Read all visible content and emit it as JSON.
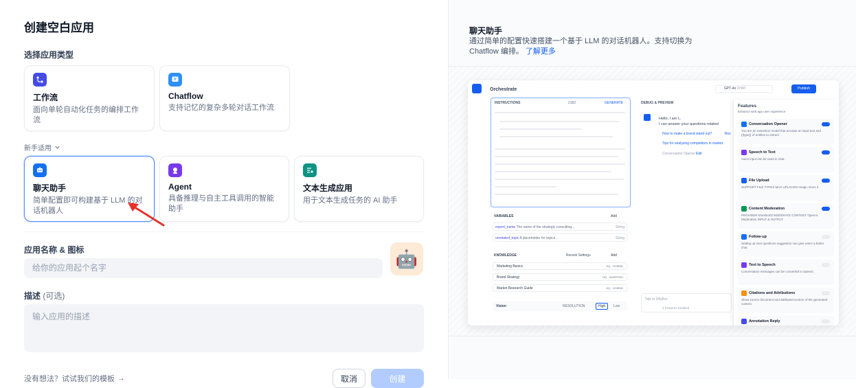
{
  "page": {
    "title": "创建空白应用"
  },
  "app_type": {
    "label": "选择应用类型",
    "cards": [
      {
        "name": "工作流",
        "desc": "面向单轮自动化任务的编排工作流",
        "color": "#444ce7"
      },
      {
        "name": "Chatflow",
        "desc": "支持记忆的复杂多轮对话工作流",
        "color": "#0e9384"
      }
    ],
    "beginner_label": "新手适用",
    "beginner_cards": [
      {
        "name": "聊天助手",
        "desc": "简单配置即可构建基于 LLM 的对话机器人",
        "color": "#1570ef"
      },
      {
        "name": "Agent",
        "desc": "具备推理与自主工具调用的智能助手",
        "color": "#7839ee"
      },
      {
        "name": "文本生成应用",
        "desc": "用于文本生成任务的 AI 助手",
        "color": "#0e9384"
      }
    ]
  },
  "name_field": {
    "label": "应用名称 & 图标",
    "placeholder": "给你的应用起个名字"
  },
  "desc_field": {
    "label": "描述",
    "optional": "(可选)",
    "placeholder": "输入应用的描述"
  },
  "footer": {
    "template_hint": "没有想法？试试我们的模板",
    "cancel": "取消",
    "create": "创建"
  },
  "preview": {
    "title": "聊天助手",
    "desc": "通过简单的配置快速搭建一个基于 LLM 的对话机器人。支持切换为 Chatflow 编排。",
    "link": "了解更多"
  },
  "mock": {
    "orchestrate": "Orchestrate",
    "model": "GPT-4o",
    "model_badge": "CHAT",
    "publish": "Publish",
    "instructions": "INSTRUCTIONS",
    "count": "2182",
    "generate": "GENERATE",
    "debug": "DEBUG & PREVIEW",
    "hello1": "Hello, I am L.",
    "hello2": "I can answer your questions related",
    "q1": "How to make a brand stand out?",
    "q1b": "Bes",
    "q2": "Tips for analyzing competitors in market",
    "opener_label": "Conversation Opener",
    "edit": "Edit",
    "variables": "VARIABLES",
    "add": "Add",
    "vars": [
      {
        "key": "expert_name",
        "desc": "The name of the strategic consulting...",
        "type": "String"
      },
      {
        "key": "unrelated_topic",
        "desc": "A placeholder for topics...",
        "req": "REQUIRED",
        "type": "String"
      }
    ],
    "knowledge": "KNOWLEDGE",
    "rerank": "Rerank Settings",
    "kb": [
      {
        "name": "Marketing Basics",
        "tag": "HQ · HYBRID"
      },
      {
        "name": "Brand Strategy",
        "tag": "HQ · INVERTED"
      },
      {
        "name": "Market Research Guide",
        "tag": "HQ · HYBRID"
      }
    ],
    "vision": "Vision",
    "resolution": "RESOLUTION",
    "high": "High",
    "low": "Low",
    "talk": "Talk to DifyBot",
    "features_enabled": "4 Features Enabled",
    "features_title": "Features",
    "features_sub": "Enhance web app user experience",
    "features": [
      {
        "name": "Conversation Opener",
        "desc": "You are an extraction model that accepts an input text and {{type}} of entities to extract.",
        "on": true,
        "color": "#1570ef"
      },
      {
        "name": "Speech to Text",
        "desc": "Voice input can be used in chat.",
        "on": true,
        "color": "#7839ee"
      },
      {
        "name": "File Upload",
        "desc": "SUPPORT FILE TYPES  MAX UPLOADS  Image, Docs  3",
        "on": true,
        "color": "#155eef"
      },
      {
        "name": "Content Moderation",
        "desc": "PROVIDER  ENABLED MODERATE CONTENT  OpenAI Moderation  INPUT & OUTPUT",
        "on": true,
        "color": "#039855"
      },
      {
        "name": "Follow-up",
        "desc": "Setting up next questions suggestion can give users a better chat.",
        "on": false,
        "color": "#1570ef"
      },
      {
        "name": "Text to Speech",
        "desc": "Conversation messages can be converted to speech.",
        "on": false,
        "color": "#7839ee"
      },
      {
        "name": "Citations and Attributions",
        "desc": "Show source document and attributed section of the generated content.",
        "on": false,
        "color": "#f79009"
      },
      {
        "name": "Annotation Reply",
        "desc": "",
        "on": false,
        "color": "#444ce7"
      }
    ]
  }
}
